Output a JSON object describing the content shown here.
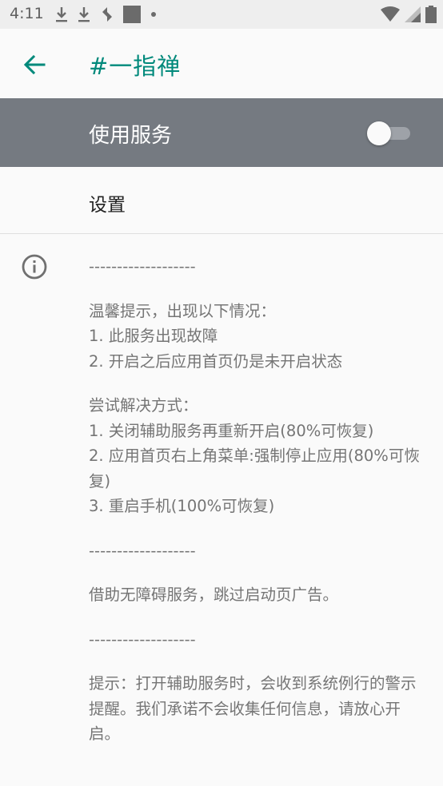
{
  "status_bar": {
    "time": "4:11",
    "left_icons": [
      "download-icon",
      "download-icon",
      "sync-icon",
      "square-icon",
      "dot-icon"
    ],
    "right_icons": [
      "wifi-icon",
      "signal-icon",
      "battery-icon"
    ]
  },
  "app_bar": {
    "back_icon": "arrow-back-icon",
    "title": "#一指禅",
    "accent_color": "#00897b"
  },
  "service": {
    "label": "使用服务",
    "toggle_on": false,
    "row_color": "#757a81"
  },
  "settings": {
    "label": "设置"
  },
  "info": {
    "icon": "info-icon",
    "divider1": "-------------------",
    "tip_title": "温馨提示，出现以下情况：",
    "tip_1": "1. 此服务出现故障",
    "tip_2": "2. 开启之后应用首页仍是未开启状态",
    "solve_title": "尝试解决方式：",
    "solve_1": "1. 关闭辅助服务再重新开启(80%可恢复)",
    "solve_2": "2. 应用首页右上角菜单:强制停止应用(80%可恢复)",
    "solve_3": "3. 重启手机(100%可恢复)",
    "divider2": "-------------------",
    "purpose": "借助无障碍服务，跳过启动页广告。",
    "divider3": "-------------------",
    "notice": "提示：打开辅助服务时，会收到系统例行的警示提醒。我们承诺不会收集任何信息，请放心开启。"
  }
}
